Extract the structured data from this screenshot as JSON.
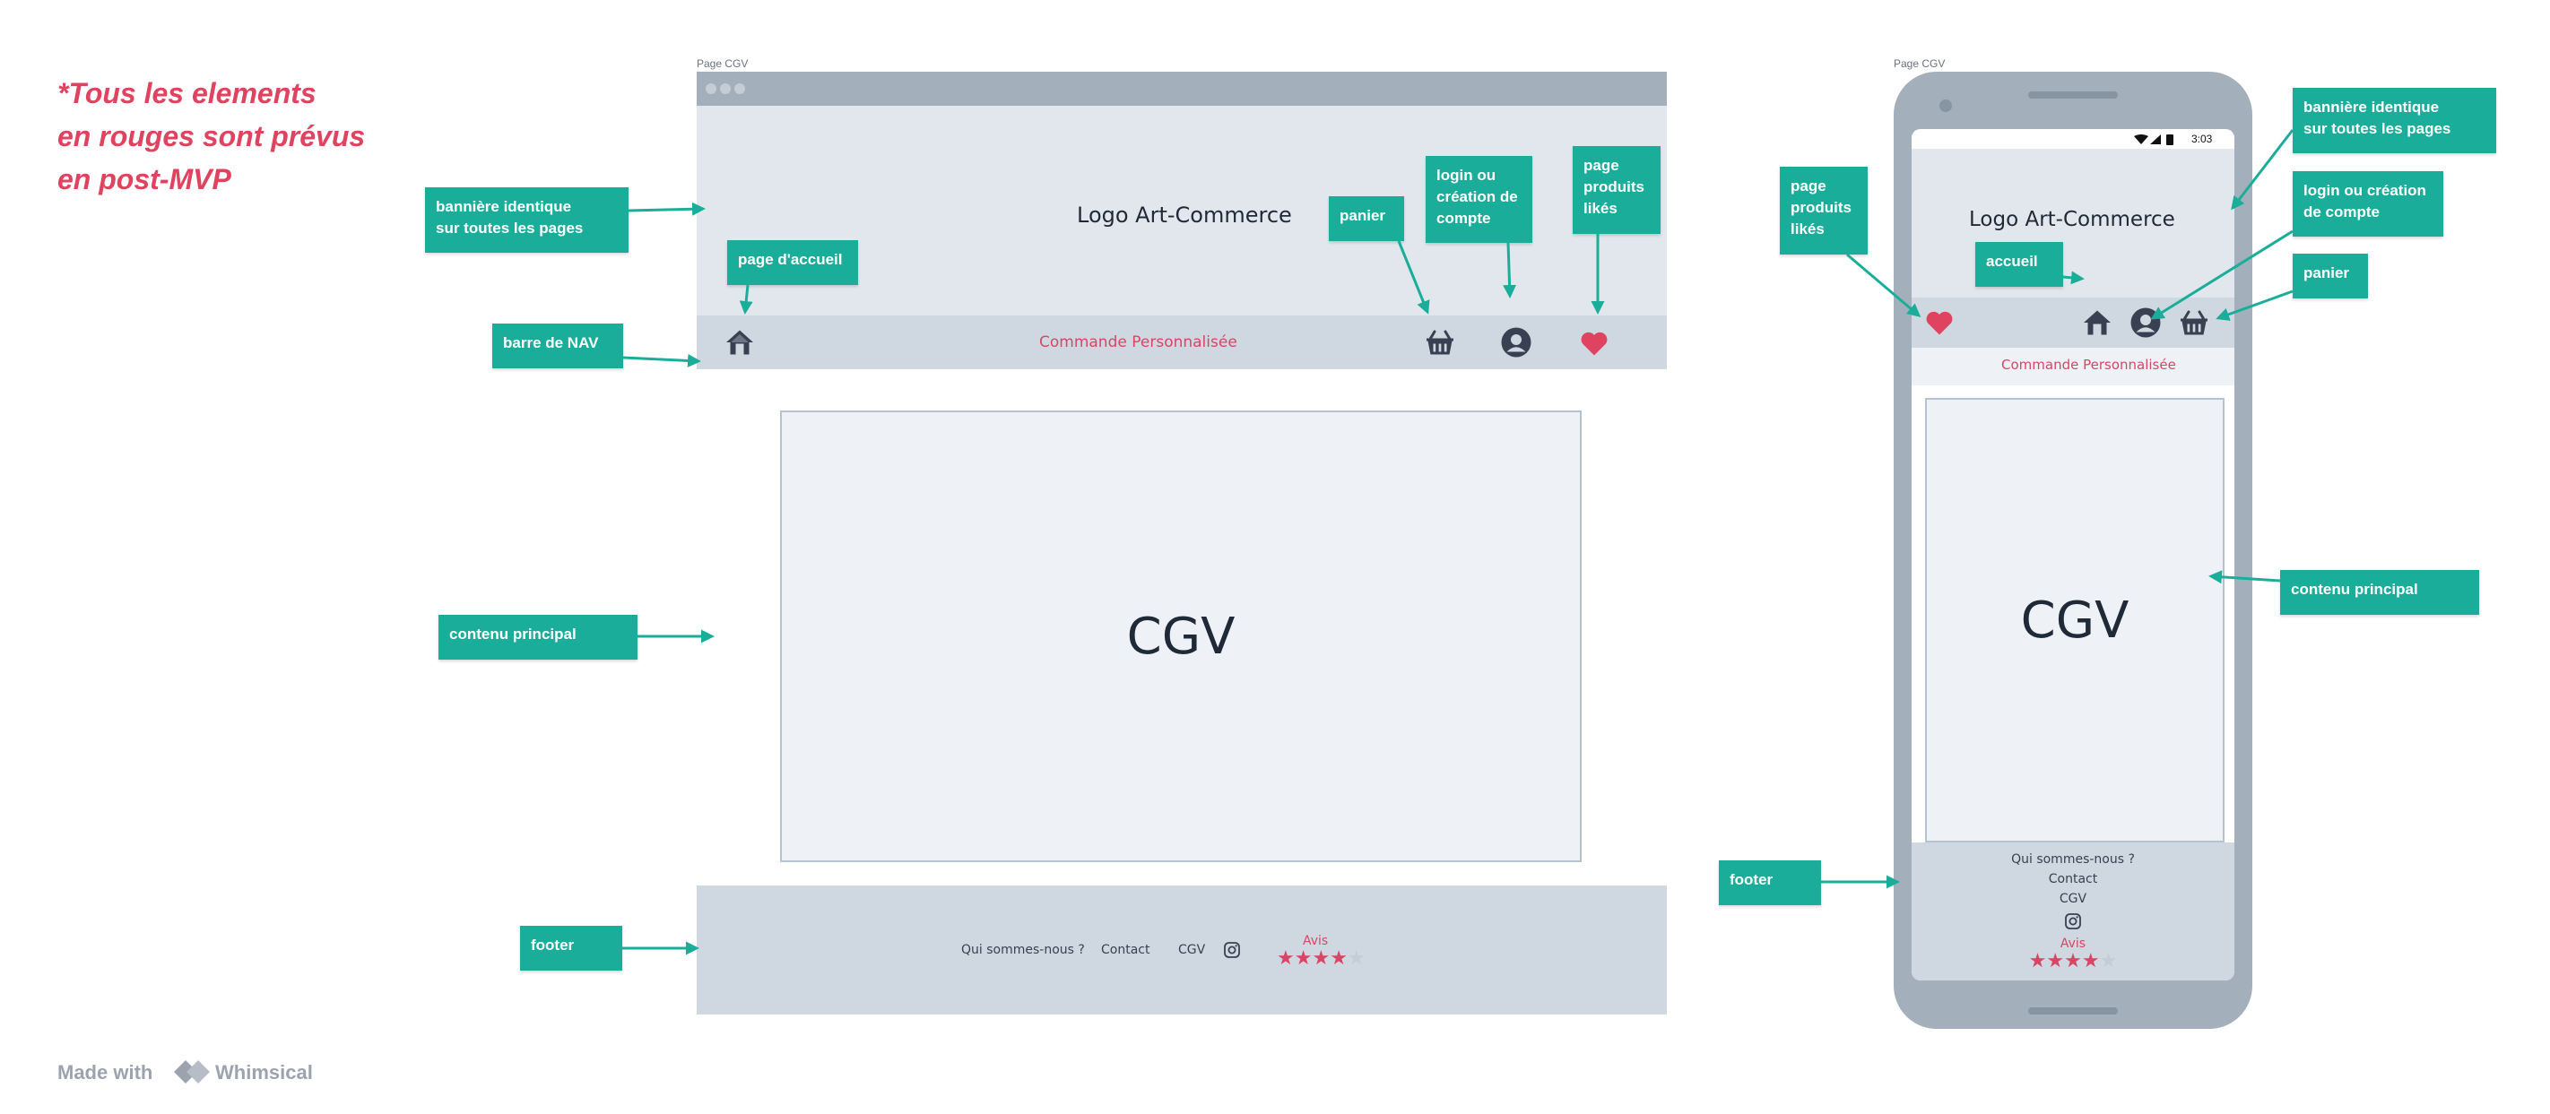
{
  "note": {
    "lines": [
      "*Tous les elements",
      "en rouges sont prévus",
      "en post-MVP"
    ]
  },
  "desktop": {
    "frame_label": "Page CGV",
    "logo": "Logo Art-Commerce",
    "nav_link": "Commande Personnalisée",
    "content_title": "CGV",
    "footer": {
      "about": "Qui sommes-nous ?",
      "contact": "Contact",
      "cgv": "CGV",
      "avis_label": "Avis"
    }
  },
  "mobile": {
    "frame_label": "Page CGV",
    "status_time": "3:03",
    "logo": "Logo Art-Commerce",
    "nav_link": "Commande Personnalisée",
    "content_title": "CGV",
    "footer": {
      "about": "Qui sommes-nous ?",
      "contact": "Contact",
      "cgv": "CGV",
      "avis_label": "Avis"
    }
  },
  "rating": {
    "filled": 4,
    "total": 5
  },
  "annotations": {
    "banner": [
      "bannière identique",
      "sur toutes les pages"
    ],
    "home_page": "page d'accueil",
    "nav_bar": "barre de NAV",
    "main_content": "contenu principal",
    "footer": "footer",
    "cart": "panier",
    "login": [
      "login  ou",
      "création de",
      "compte"
    ],
    "liked": [
      "page",
      "produits",
      "likés"
    ],
    "m_liked": [
      "page",
      "produits",
      "likés"
    ],
    "m_home": "accueil",
    "m_banner": [
      "bannière identique",
      "sur toutes les pages"
    ],
    "m_login": [
      "login  ou création",
      "de compte"
    ],
    "m_cart": "panier",
    "m_content": "contenu principal",
    "m_footer": "footer"
  },
  "colors": {
    "accent": "#1aae9a",
    "red": "#e0435f",
    "frame": "#a3b0bc",
    "banner": "#e2e7ee",
    "nav": "#cfd8e1",
    "star_filled": "#d94565",
    "star_empty": "#c4ccd4"
  },
  "icons": [
    "home-icon",
    "basket-icon",
    "user-icon",
    "heart-icon",
    "instagram-icon",
    "star-icon",
    "whimsical-logo-icon"
  ],
  "branding": {
    "made_with": "Made with",
    "brand": "Whimsical"
  }
}
